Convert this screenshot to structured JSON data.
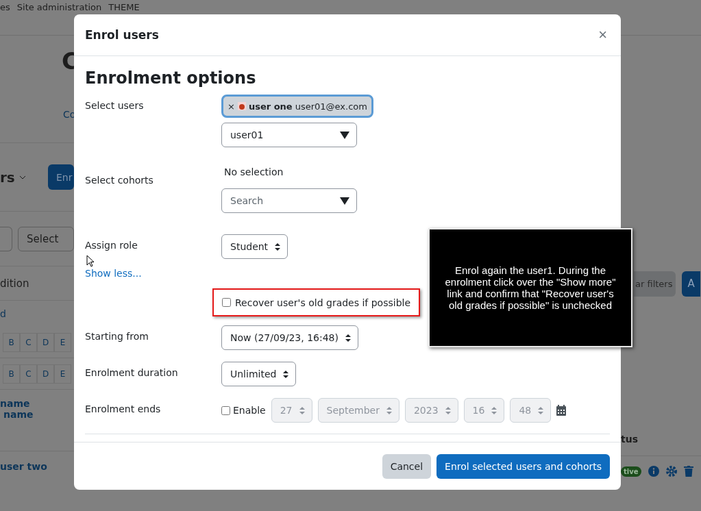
{
  "background_page": {
    "nav_items": [
      "es",
      "Site administration",
      "THEME"
    ],
    "heading_fragment": "C",
    "link_fragment": "Co",
    "title_fragment": "rs",
    "button_fragment": "Enr",
    "filter_select": "Select",
    "header_fragment": "dition",
    "link_fragment_2": "d",
    "initials_rows": [
      [
        "B",
        "C",
        "D",
        "E"
      ],
      [
        "B",
        "C",
        "D",
        "E"
      ]
    ],
    "name_headers": [
      "name",
      "name"
    ],
    "user_row": "user two",
    "clear_filters": "ar filters",
    "apply_fragment": "A",
    "status_header": "tus",
    "status_badge": "tive"
  },
  "modal": {
    "title": "Enrol users",
    "close": "×",
    "heading": "Enrolment options",
    "fields": [
      {
        "kind": "autocomplete",
        "label": "Select users",
        "chips": [
          {
            "remove": "×",
            "name": "user one",
            "email": "user01@ex.com"
          }
        ],
        "value": "user01"
      },
      {
        "kind": "cohorts",
        "label": "Select cohorts",
        "selection_text": "No selection",
        "placeholder": "Search"
      },
      {
        "kind": "select",
        "label": "Assign role",
        "value": "Student"
      },
      {
        "kind": "link",
        "text": "Show less..."
      },
      {
        "kind": "checkbox",
        "label": "Recover user's old grades if possible",
        "checked": false,
        "highlighted": true
      },
      {
        "kind": "select",
        "label": "Starting from",
        "value": "Now (27/09/23, 16:48)"
      },
      {
        "kind": "select",
        "label": "Enrolment duration",
        "value": "Unlimited"
      },
      {
        "kind": "date",
        "label": "Enrolment ends",
        "enable_label": "Enable",
        "checked": false,
        "parts": [
          "27",
          "September",
          "2023",
          "16",
          "48"
        ]
      }
    ],
    "buttons": [
      {
        "label": "Cancel",
        "primary": false
      },
      {
        "label": "Enrol selected users and cohorts",
        "primary": true
      }
    ]
  },
  "instruction": "Enrol again the user1. During the enrolment click over the \"Show more\" link and confirm that \"Recover user's old grades if possible\" is unchecked"
}
